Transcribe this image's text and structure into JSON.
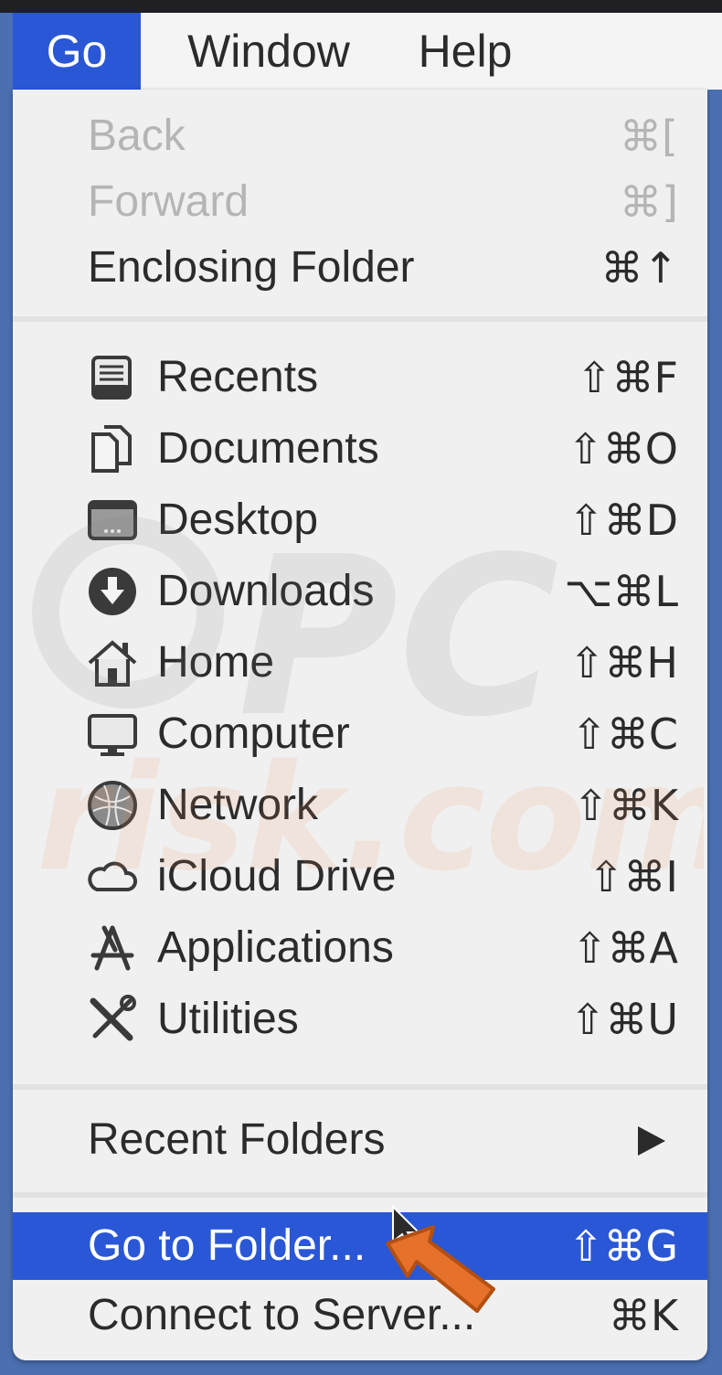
{
  "menubar": {
    "items": [
      "Go",
      "Window",
      "Help"
    ],
    "active": "Go"
  },
  "menu": {
    "nav_items": [
      {
        "label": "Back",
        "shortcut": "⌘[",
        "enabled": false
      },
      {
        "label": "Forward",
        "shortcut": "⌘]",
        "enabled": false
      },
      {
        "label": "Enclosing Folder",
        "shortcut": "⌘↑",
        "enabled": true
      }
    ],
    "places": [
      {
        "label": "Recents",
        "shortcut": "⇧⌘F",
        "icon": "recents-icon"
      },
      {
        "label": "Documents",
        "shortcut": "⇧⌘O",
        "icon": "documents-icon"
      },
      {
        "label": "Desktop",
        "shortcut": "⇧⌘D",
        "icon": "desktop-icon"
      },
      {
        "label": "Downloads",
        "shortcut": "⌥⌘L",
        "icon": "downloads-icon"
      },
      {
        "label": "Home",
        "shortcut": "⇧⌘H",
        "icon": "home-icon"
      },
      {
        "label": "Computer",
        "shortcut": "⇧⌘C",
        "icon": "computer-icon"
      },
      {
        "label": "Network",
        "shortcut": "⇧⌘K",
        "icon": "network-icon"
      },
      {
        "label": "iCloud Drive",
        "shortcut": "⇧⌘I",
        "icon": "icloud-icon"
      },
      {
        "label": "Applications",
        "shortcut": "⇧⌘A",
        "icon": "applications-icon"
      },
      {
        "label": "Utilities",
        "shortcut": "⇧⌘U",
        "icon": "utilities-icon"
      }
    ],
    "recent_folders": {
      "label": "Recent Folders"
    },
    "goto_folder": {
      "label": "Go to Folder...",
      "shortcut": "⇧⌘G",
      "highlighted": true
    },
    "connect_server": {
      "label": "Connect to Server...",
      "shortcut": "⌘K"
    }
  },
  "watermark": {
    "text": "PC risk.com"
  },
  "colors": {
    "highlight": "#2a57d6",
    "menu_bg": "#f0f0f0",
    "disabled_text": "#b5b5b5",
    "desktop_bg": "#4b70b2",
    "pointer_arrow": "#e5712a"
  }
}
